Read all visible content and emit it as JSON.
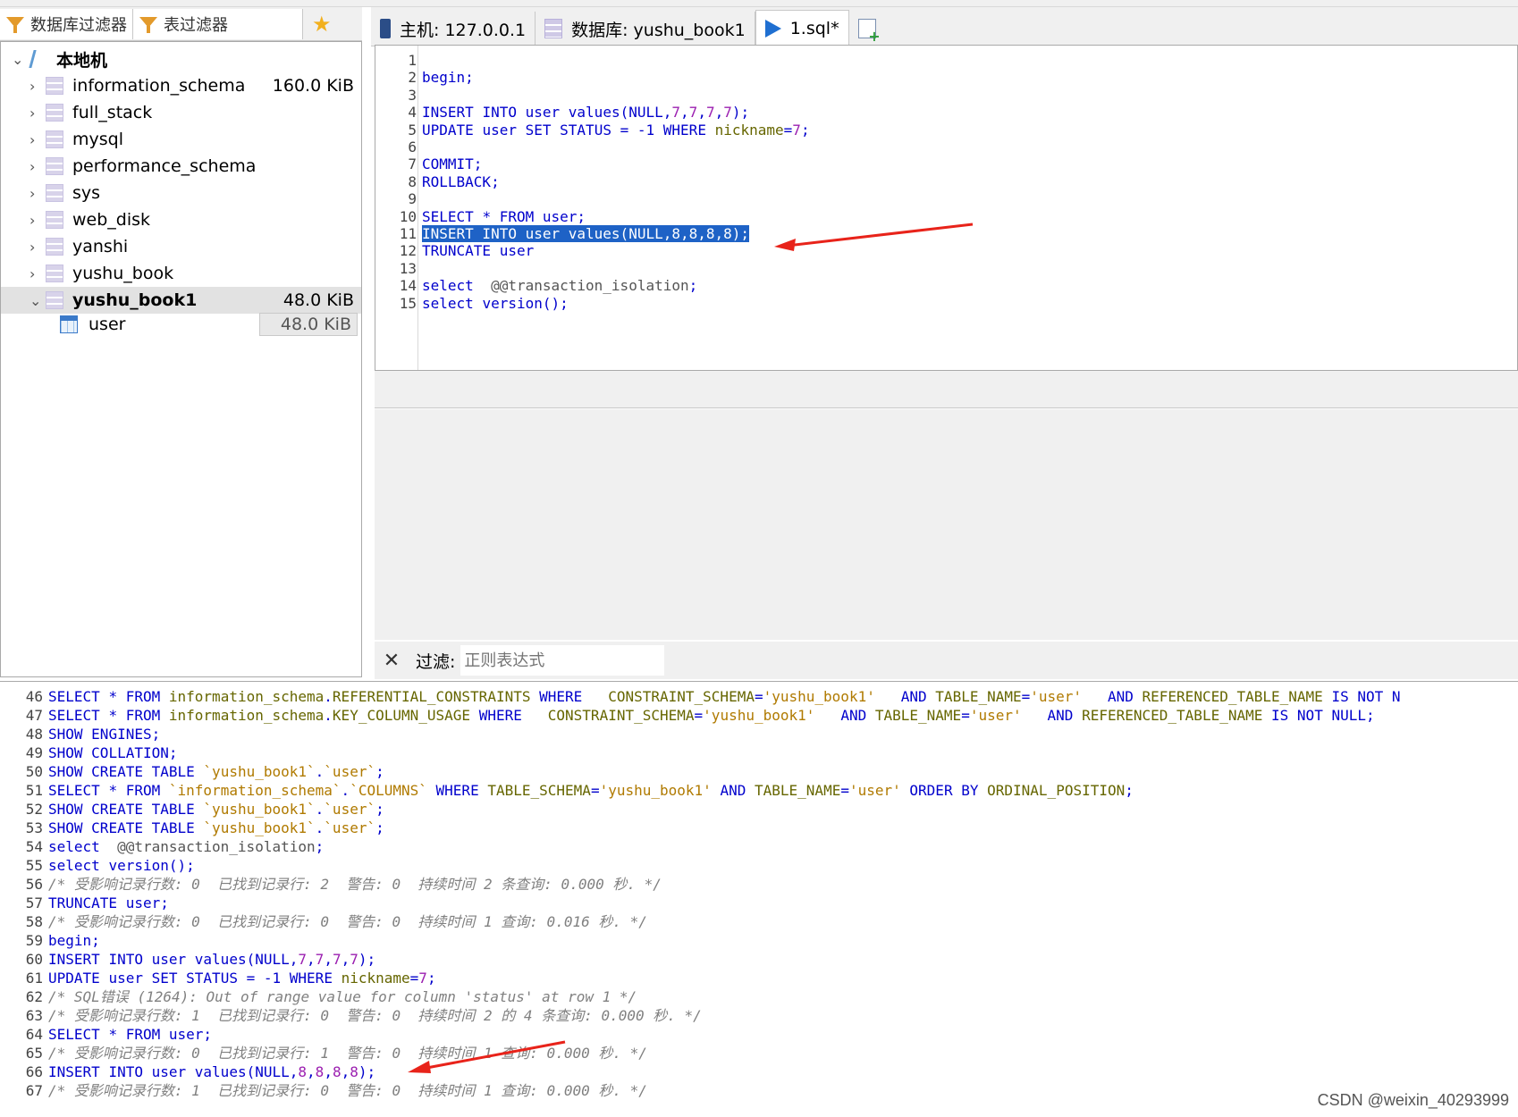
{
  "filter_tabs": {
    "db_filter": "数据库过滤器",
    "table_filter": "表过滤器"
  },
  "tabs": [
    {
      "label": "主机: 127.0.0.1"
    },
    {
      "label": "数据库: yushu_book1"
    },
    {
      "label": "1.sql*"
    }
  ],
  "tree": {
    "host": "本地机",
    "databases": [
      {
        "name": "information_schema",
        "size": "160.0 KiB"
      },
      {
        "name": "full_stack",
        "size": ""
      },
      {
        "name": "mysql",
        "size": ""
      },
      {
        "name": "performance_schema",
        "size": ""
      },
      {
        "name": "sys",
        "size": ""
      },
      {
        "name": "web_disk",
        "size": ""
      },
      {
        "name": "yanshi",
        "size": ""
      },
      {
        "name": "yushu_book",
        "size": ""
      },
      {
        "name": "yushu_book1",
        "size": "48.0 KiB"
      }
    ],
    "table": {
      "name": "user",
      "size": "48.0 KiB"
    }
  },
  "editor_lines": [
    {
      "n": "1",
      "t": ""
    },
    {
      "n": "2",
      "t": "begin;"
    },
    {
      "n": "3",
      "t": ""
    },
    {
      "n": "4",
      "t": "INSERT INTO user values(NULL,7,7,7,7);"
    },
    {
      "n": "5",
      "t": "UPDATE user SET STATUS = -1 WHERE nickname=7;"
    },
    {
      "n": "6",
      "t": ""
    },
    {
      "n": "7",
      "t": "COMMIT;"
    },
    {
      "n": "8",
      "t": "ROLLBACK;"
    },
    {
      "n": "9",
      "t": ""
    },
    {
      "n": "10",
      "t": "SELECT * FROM user;"
    },
    {
      "n": "11",
      "t": "INSERT INTO user values(NULL,8,8,8,8);"
    },
    {
      "n": "12",
      "t": "TRUNCATE user"
    },
    {
      "n": "13",
      "t": ""
    },
    {
      "n": "14",
      "t": "select  @@transaction_isolation;"
    },
    {
      "n": "15",
      "t": "select version();"
    }
  ],
  "filter": {
    "label": "过滤:",
    "placeholder": "正则表达式"
  },
  "log_lines": [
    {
      "n": "46",
      "t": "SELECT * FROM information_schema.REFERENTIAL_CONSTRAINTS WHERE   CONSTRAINT_SCHEMA='yushu_book1'   AND TABLE_NAME='user'   AND REFERENCED_TABLE_NAME IS NOT N"
    },
    {
      "n": "47",
      "t": "SELECT * FROM information_schema.KEY_COLUMN_USAGE WHERE   CONSTRAINT_SCHEMA='yushu_book1'   AND TABLE_NAME='user'   AND REFERENCED_TABLE_NAME IS NOT NULL;"
    },
    {
      "n": "48",
      "t": "SHOW ENGINES;"
    },
    {
      "n": "49",
      "t": "SHOW COLLATION;"
    },
    {
      "n": "50",
      "t": "SHOW CREATE TABLE `yushu_book1`.`user`;"
    },
    {
      "n": "51",
      "t": "SELECT * FROM `information_schema`.`COLUMNS` WHERE TABLE_SCHEMA='yushu_book1' AND TABLE_NAME='user' ORDER BY ORDINAL_POSITION;"
    },
    {
      "n": "52",
      "t": "SHOW CREATE TABLE `yushu_book1`.`user`;"
    },
    {
      "n": "53",
      "t": "SHOW CREATE TABLE `yushu_book1`.`user`;"
    },
    {
      "n": "54",
      "t": "select  @@transaction_isolation;"
    },
    {
      "n": "55",
      "t": "select version();"
    },
    {
      "n": "56",
      "t": "/* 受影响记录行数: 0  已找到记录行: 2  警告: 0  持续时间 2 条查询: 0.000 秒. */"
    },
    {
      "n": "57",
      "t": "TRUNCATE user;"
    },
    {
      "n": "58",
      "t": "/* 受影响记录行数: 0  已找到记录行: 0  警告: 0  持续时间 1 查询: 0.016 秒. */"
    },
    {
      "n": "59",
      "t": "begin;"
    },
    {
      "n": "60",
      "t": "INSERT INTO user values(NULL,7,7,7,7);"
    },
    {
      "n": "61",
      "t": "UPDATE user SET STATUS = -1 WHERE nickname=7;"
    },
    {
      "n": "62",
      "t": "/* SQL错误 (1264): Out of range value for column 'status' at row 1 */"
    },
    {
      "n": "63",
      "t": "/* 受影响记录行数: 1  已找到记录行: 0  警告: 0  持续时间 2 的 4 条查询: 0.000 秒. */"
    },
    {
      "n": "64",
      "t": "SELECT * FROM user;"
    },
    {
      "n": "65",
      "t": "/* 受影响记录行数: 0  已找到记录行: 1  警告: 0  持续时间 1 查询: 0.000 秒. */"
    },
    {
      "n": "66",
      "t": "INSERT INTO user values(NULL,8,8,8,8);"
    },
    {
      "n": "67",
      "t": "/* 受影响记录行数: 1  已找到记录行: 0  警告: 0  持续时间 1 查询: 0.000 秒. */"
    }
  ],
  "watermark": "CSDN @weixin_40293999",
  "colors": {
    "keyword": "#0000cc",
    "number": "#9b1fb0",
    "selection": "#1e62c6",
    "arrow": "#e8231a"
  }
}
